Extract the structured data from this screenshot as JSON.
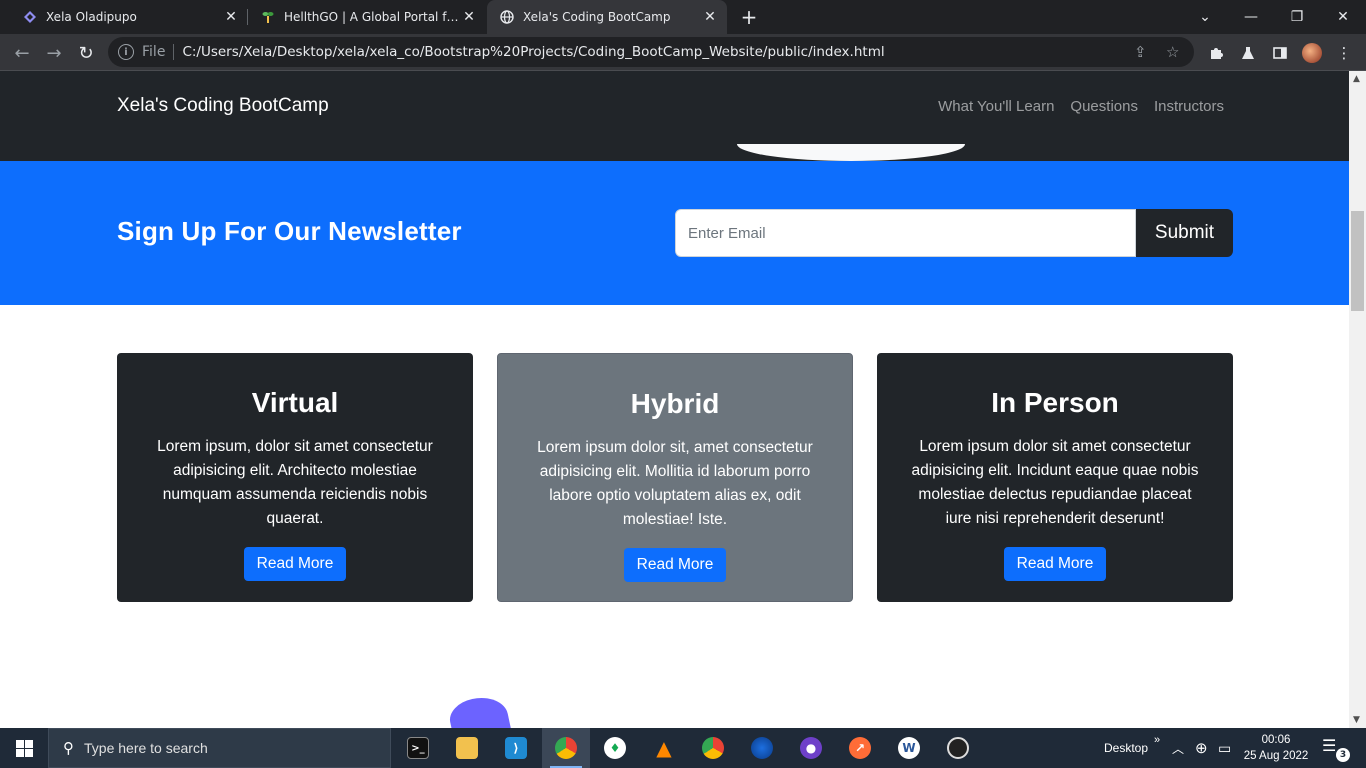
{
  "browser": {
    "tabs": [
      {
        "title": "Xela Oladipupo",
        "favicon": "diamond-icon",
        "close": "✕"
      },
      {
        "title": "HellthGO | A Global Portal for Ge",
        "favicon": "plant-icon",
        "close": "✕"
      },
      {
        "title": "Xela's Coding BootCamp",
        "favicon": "globe-icon",
        "close": "✕"
      }
    ],
    "new_tab": "+",
    "address_prefix": "File",
    "url": "C:/Users/Xela/Desktop/xela/xela_co/Bootstrap%20Projects/Coding_BootCamp_Website/public/index.html"
  },
  "site": {
    "brand": "Xela's Coding BootCamp",
    "nav": [
      "What You'll Learn",
      "Questions",
      "Instructors"
    ],
    "newsletter": {
      "heading": "Sign Up For Our Newsletter",
      "placeholder": "Enter Email",
      "submit": "Submit"
    },
    "cards": [
      {
        "title": "Virtual",
        "text": "Lorem ipsum, dolor sit amet consectetur adipisicing elit. Architecto molestiae numquam assumenda reiciendis nobis quaerat.",
        "button": "Read More"
      },
      {
        "title": "Hybrid",
        "text": "Lorem ipsum dolor sit, amet consectetur adipisicing elit. Mollitia id laborum porro labore optio voluptatem alias ex, odit molestiae! Iste.",
        "button": "Read More"
      },
      {
        "title": "In Person",
        "text": "Lorem ipsum dolor sit amet consectetur adipisicing elit. Incidunt eaque quae nobis molestiae delectus repudiandae placeat iure nisi reprehenderit deserunt!",
        "button": "Read More"
      }
    ]
  },
  "taskbar": {
    "search_placeholder": "Type here to search",
    "desktop_label": "Desktop",
    "time": "00:06",
    "date": "25 Aug 2022",
    "notification_count": "3"
  },
  "colors": {
    "navbar": "#212529",
    "primary": "#0d6efd",
    "card_dark": "#212529",
    "card_grey": "#6c757d"
  }
}
